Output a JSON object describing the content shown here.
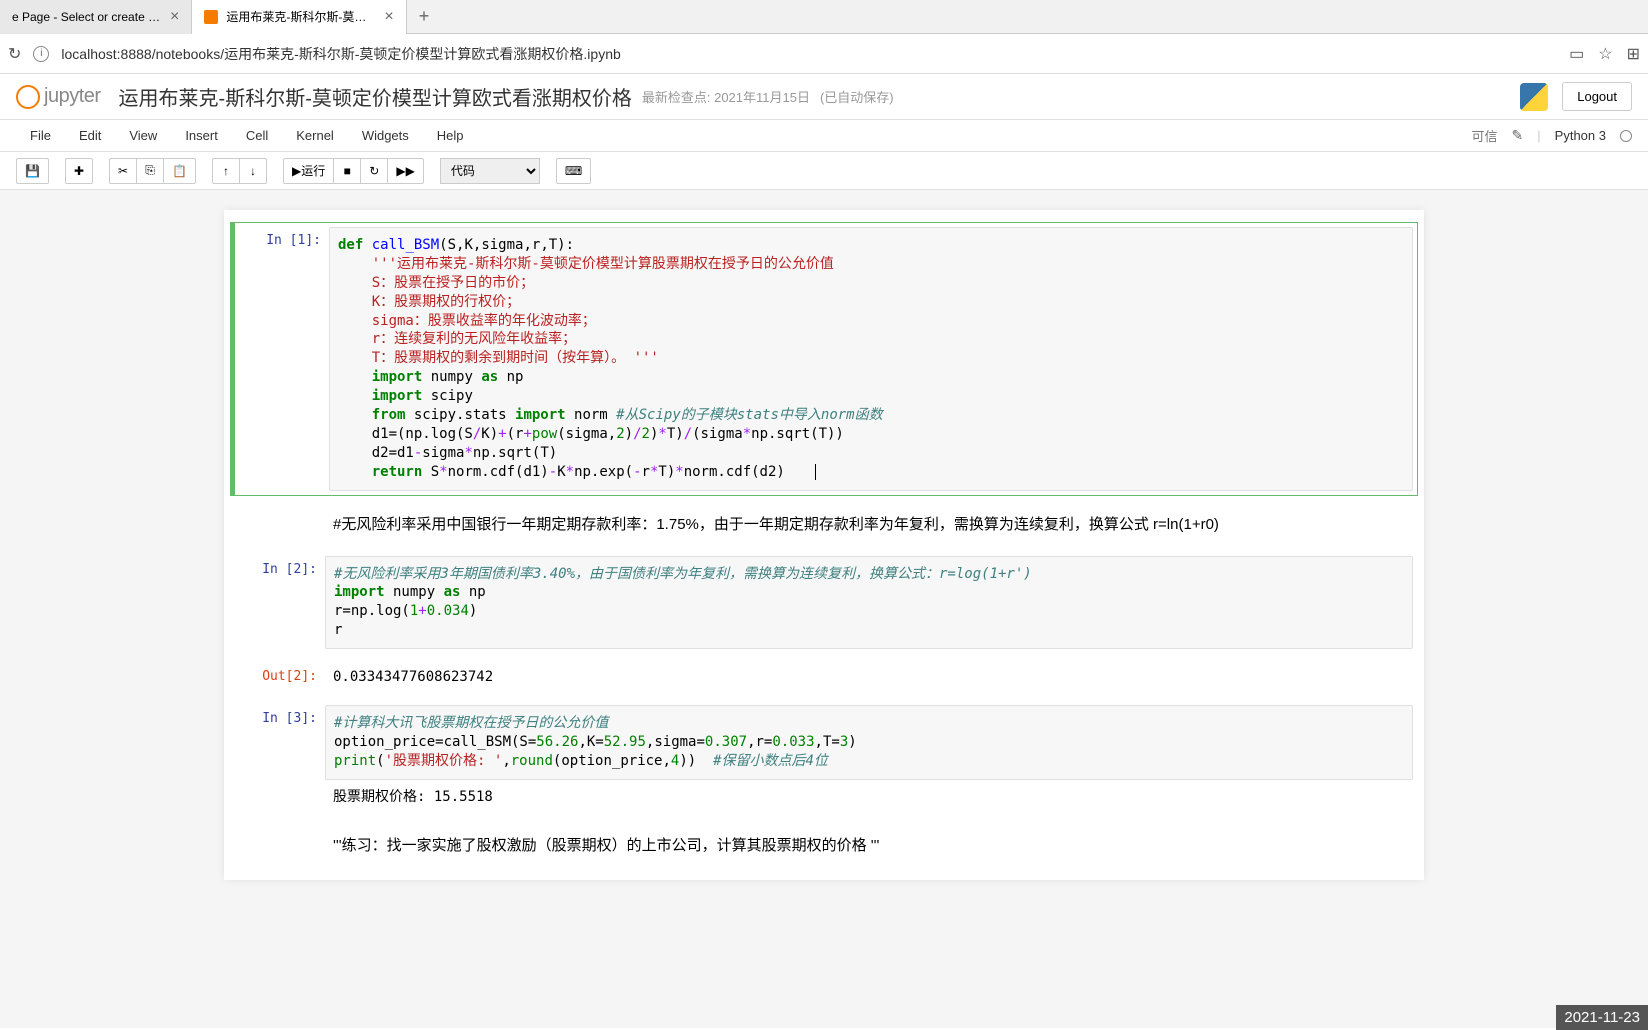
{
  "browser": {
    "tab1": "e Page - Select or create a n",
    "tab2": "运用布莱克-斯科尔斯-莫顿定价模…",
    "url": "localhost:8888/notebooks/运用布莱克-斯科尔斯-莫顿定价模型计算欧式看涨期权价格.ipynb"
  },
  "header": {
    "logo_text": "jupyter",
    "title": "运用布莱克-斯科尔斯-莫顿定价模型计算欧式看涨期权价格",
    "checkpoint": "最新检查点: 2021年11月15日",
    "autosave": "(已自动保存)",
    "logout": "Logout"
  },
  "menu": {
    "file": "File",
    "edit": "Edit",
    "view": "View",
    "insert": "Insert",
    "cell": "Cell",
    "kernel": "Kernel",
    "widgets": "Widgets",
    "help": "Help",
    "trusted": "可信",
    "kernel_name": "Python 3"
  },
  "toolbar": {
    "run": "运行",
    "celltype": "代码"
  },
  "cells": {
    "in1_prompt": "In  [1]:",
    "in2_prompt": "In  [2]:",
    "out2_prompt": "Out[2]:",
    "in3_prompt": "In  [3]:",
    "md1": "#无风险利率采用中国银行一年期定期存款利率：1.75%，由于一年期定期存款利率为年复利，需换算为连续复利，换算公式 r=ln(1+r0)",
    "out2": "0.03343477608623742",
    "out3": "股票期权价格:  15.5518",
    "md2": "'''练习：找一家实施了股权激励（股票期权）的上市公司，计算其股票期权的价格 '''"
  },
  "timestamp": "2021-11-23"
}
